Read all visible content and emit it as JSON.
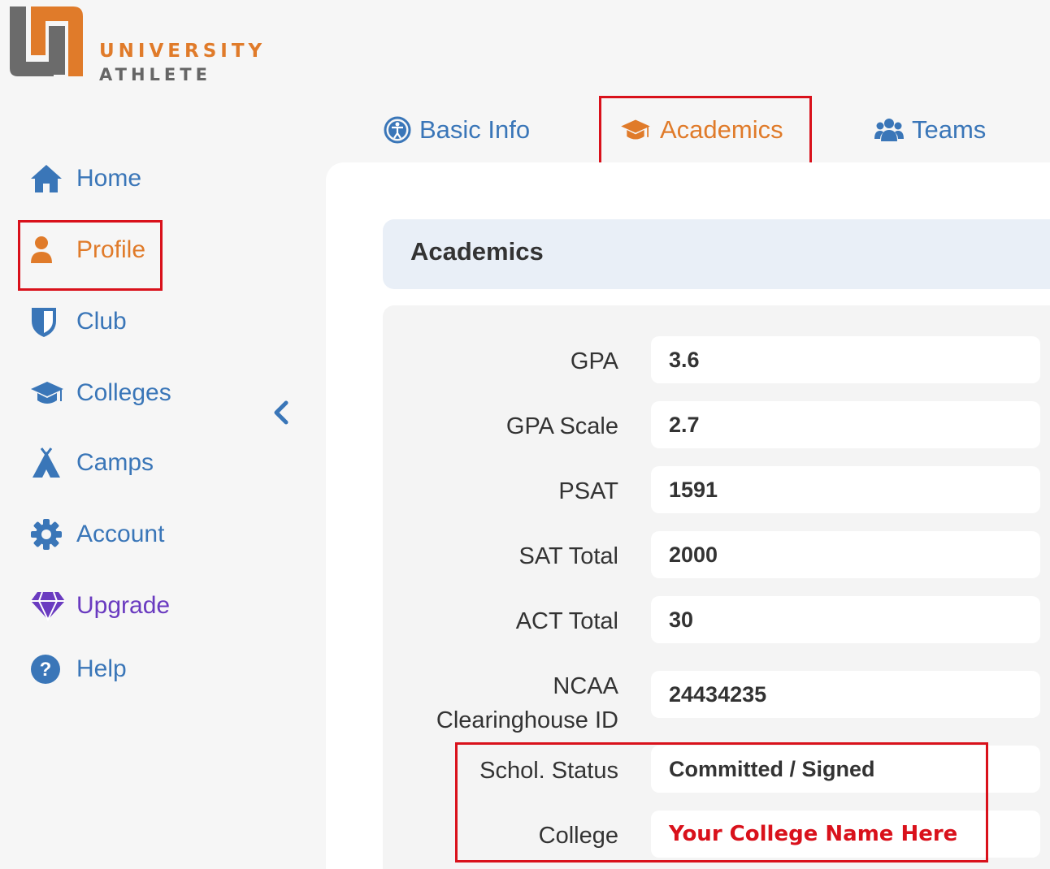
{
  "logo": {
    "line1": "UNIVERSITY",
    "line2": "ATHLETE"
  },
  "sidebar": {
    "items": [
      {
        "label": "Home",
        "icon": "home-icon"
      },
      {
        "label": "Profile",
        "icon": "user-icon"
      },
      {
        "label": "Club",
        "icon": "shield-icon"
      },
      {
        "label": "Colleges",
        "icon": "graduation-cap-icon"
      },
      {
        "label": "Camps",
        "icon": "tent-icon"
      },
      {
        "label": "Account",
        "icon": "gear-icon"
      },
      {
        "label": "Upgrade",
        "icon": "gem-icon"
      },
      {
        "label": "Help",
        "icon": "question-circle-icon"
      }
    ],
    "collapse_icon": "chevron-left-icon"
  },
  "tabs": [
    {
      "label": "Basic Info",
      "icon": "accessibility-icon"
    },
    {
      "label": "Academics",
      "icon": "graduation-cap-icon"
    },
    {
      "label": "Teams",
      "icon": "users-icon"
    }
  ],
  "section": {
    "title": "Academics"
  },
  "fields": {
    "gpa": {
      "label": "GPA",
      "value": "3.6"
    },
    "gpa_scale": {
      "label": "GPA Scale",
      "value": "2.7"
    },
    "psat": {
      "label": "PSAT",
      "value": "1591"
    },
    "sat_total": {
      "label": "SAT Total",
      "value": "2000"
    },
    "act_total": {
      "label": "ACT Total",
      "value": "30"
    },
    "ncaa_id": {
      "label_line1": "NCAA",
      "label_line2": "Clearinghouse ID",
      "value": "24434235"
    },
    "schol_status": {
      "label": "Schol. Status",
      "value": "Committed / Signed"
    },
    "college": {
      "label": "College",
      "value": "Your College Name Here"
    }
  },
  "colors": {
    "accent_blue": "#3a76b8",
    "accent_orange": "#e07b2a",
    "upgrade_purple": "#6a3bc0",
    "highlight_red": "#d9111b"
  }
}
